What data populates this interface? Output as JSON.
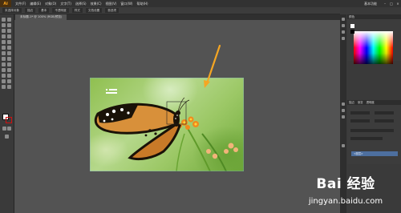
{
  "menubar": {
    "logo": "Ai",
    "items": [
      "文件(F)",
      "编辑(E)",
      "对象(O)",
      "文字(T)",
      "选择(S)",
      "效果(C)",
      "视图(V)",
      "窗口(W)",
      "帮助(H)"
    ],
    "workspace": "基本功能"
  },
  "controlbar": {
    "items": [
      "未选择对象",
      "描边",
      "基本",
      "不透明度",
      "样式",
      "文档设置",
      "首选项"
    ]
  },
  "document": {
    "tab_label": "未标题-1* @ 100% (RGB/预览)"
  },
  "panels": {
    "color_header": "颜色",
    "stroke_tabs": [
      "描边",
      "渐变",
      "透明度"
    ],
    "layer_label": "<图层>"
  },
  "watermark": {
    "brand": "Bai 经验",
    "url": "jingyan.baidu.com"
  },
  "colors": {
    "fill": "#ffffff",
    "stroke": "#d01010",
    "arrow": "#f5a623",
    "selection": "#4d6f9f"
  }
}
